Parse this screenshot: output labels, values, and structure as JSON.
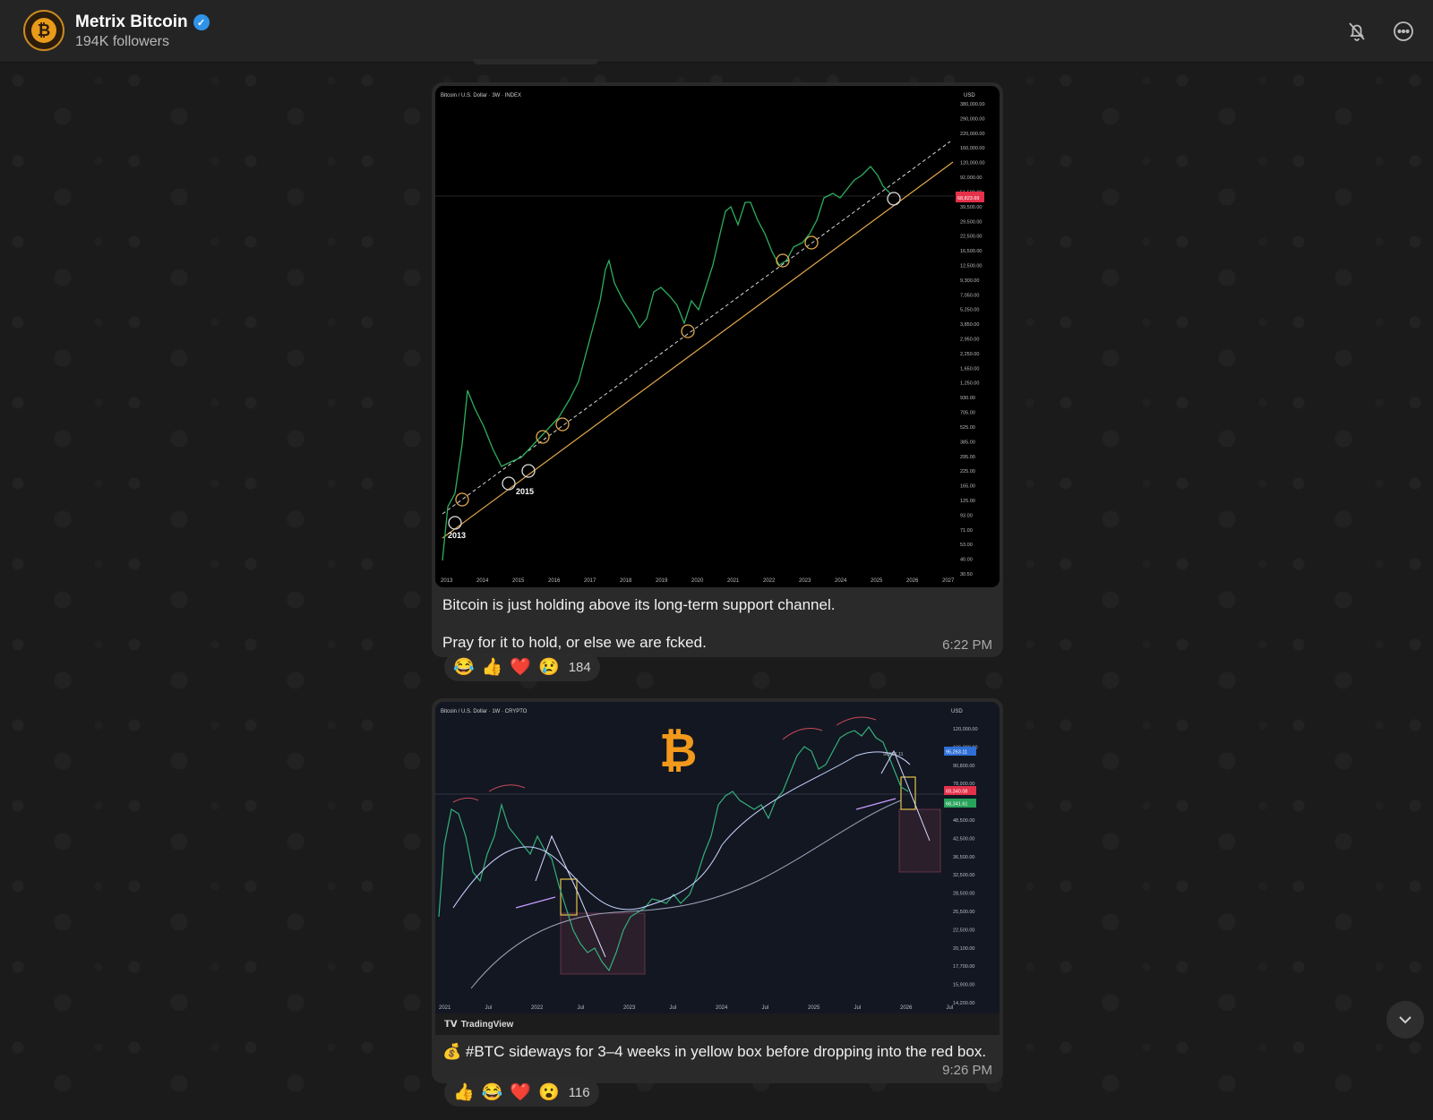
{
  "channel": {
    "name": "Metrix Bitcoin",
    "followers": "194K followers",
    "avatar_icon": "bitcoin-logo",
    "verified_icon": "verified-check-icon"
  },
  "header_actions": [
    "bell-off-icon",
    "more-options-icon"
  ],
  "messages": [
    {
      "chart": {
        "header": "Bitcoin / U.S. Dollar · 3W · INDEX",
        "currency": "USD",
        "price_tag": "68,823.69",
        "x_labels": [
          "2013",
          "2014",
          "2015",
          "2016",
          "2017",
          "2018",
          "2019",
          "2020",
          "2021",
          "2022",
          "2023",
          "2024",
          "2025",
          "2026",
          "2027"
        ],
        "y_labels": [
          "380,000.00",
          "290,000.00",
          "220,000.00",
          "160,000.00",
          "120,000.00",
          "92,000.00",
          "51,500.00",
          "39,500.00",
          "29,500.00",
          "22,500.00",
          "16,500.00",
          "12,500.00",
          "9,300.00",
          "7,050.00",
          "5,250.00",
          "3,850.00",
          "2,950.00",
          "2,250.00",
          "1,650.00",
          "1,250.00",
          "930.00",
          "705.00",
          "525.00",
          "385.00",
          "295.00",
          "225.00",
          "165.00",
          "125.00",
          "93.00",
          "71.00",
          "53.00",
          "40.00",
          "30.50"
        ],
        "annotations": [
          "2013",
          "2015"
        ]
      },
      "caption_line1": "Bitcoin is just holding above its long-term support channel.",
      "caption_line2": "Pray for it to hold, or else we are fcked.",
      "time": "6:22 PM",
      "reactions": [
        "😂",
        "👍",
        "❤️",
        "😢"
      ],
      "reaction_count": "184"
    },
    {
      "chart": {
        "header": "Bitcoin / U.S. Dollar · 1W · CRYPTO",
        "currency": "USD",
        "price_tags": [
          "95,263.11",
          "69,340.08",
          "68,341.61"
        ],
        "ema_label": "96263.11",
        "x_labels": [
          "2021",
          "Jul",
          "2022",
          "Jul",
          "2023",
          "Jul",
          "2024",
          "Jul",
          "2025",
          "Jul",
          "2026",
          "Jul"
        ],
        "y_labels": [
          "120,000.00",
          "106,000.00",
          "90,800.00",
          "78,900.00",
          "54,500.00",
          "48,500.00",
          "42,500.00",
          "36,500.00",
          "32,500.00",
          "28,500.00",
          "25,500.00",
          "22,500.00",
          "20,100.00",
          "17,700.00",
          "15,900.00",
          "14,200.00"
        ],
        "brand": "TradingView"
      },
      "caption": "💰 #BTC sideways for 3–4 weeks in yellow box before dropping into the red box.",
      "time": "9:26 PM",
      "reactions": [
        "👍",
        "😂",
        "❤️",
        "😮"
      ],
      "reaction_count": "116"
    }
  ]
}
